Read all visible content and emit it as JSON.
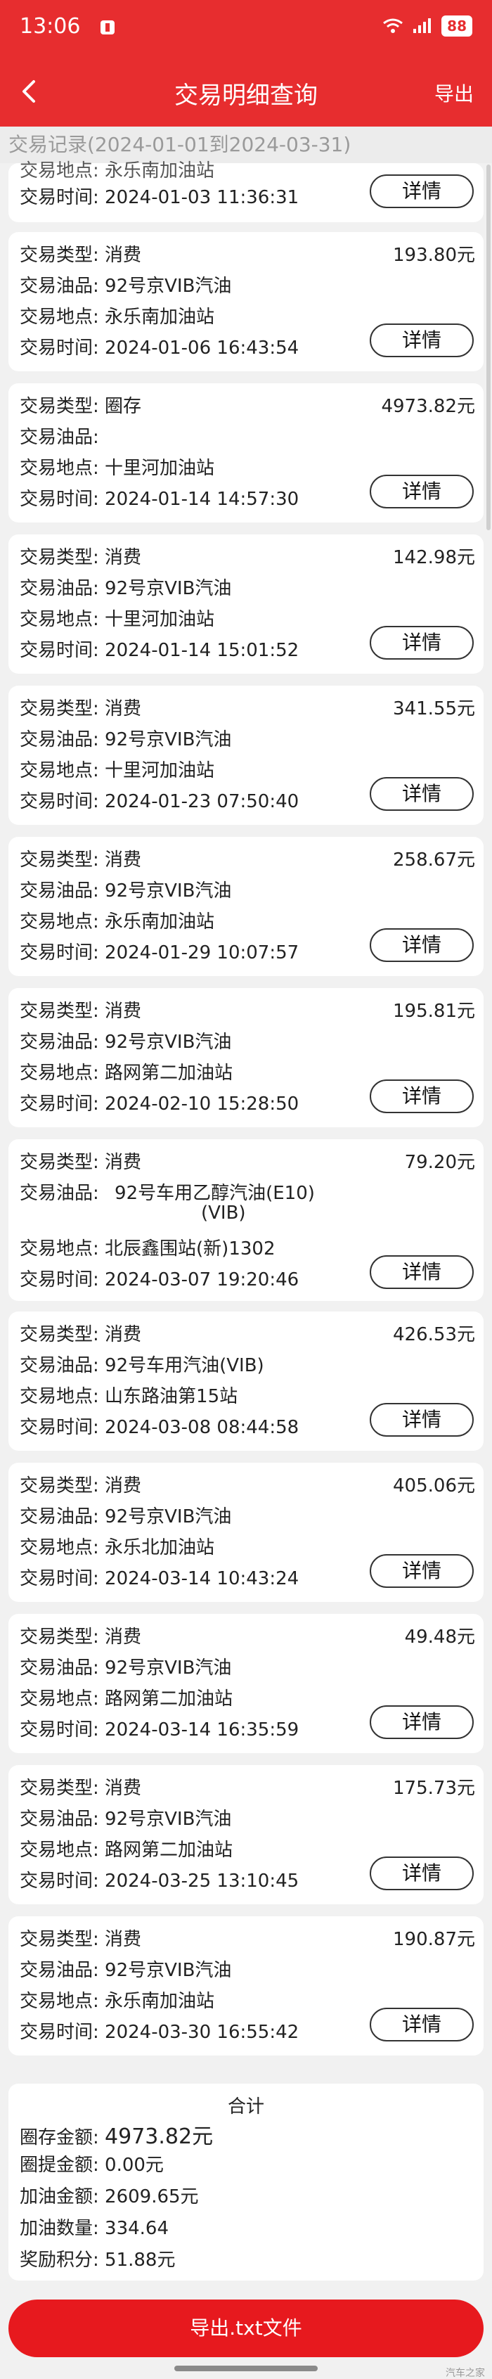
{
  "status": {
    "time": "13:06",
    "battery": "88"
  },
  "header": {
    "title": "交易明细查询",
    "export": "导出"
  },
  "subheader": "交易记录(2024-01-01到2024-03-31)",
  "labels": {
    "type": "交易类型:",
    "oil": "交易油品:",
    "place": "交易地点:",
    "time": "交易时间:",
    "detail": "详情"
  },
  "partial_record": {
    "place": "永乐南加油站",
    "time": "2024-01-03 11:36:31"
  },
  "records": [
    {
      "type": "消费",
      "amount": "193.80元",
      "oil": "92号京VIB汽油",
      "place": "永乐南加油站",
      "time": "2024-01-06 16:43:54"
    },
    {
      "type": "圈存",
      "amount": "4973.82元",
      "oil": "",
      "place": "十里河加油站",
      "time": "2024-01-14 14:57:30"
    },
    {
      "type": "消费",
      "amount": "142.98元",
      "oil": "92号京VIB汽油",
      "place": "十里河加油站",
      "time": "2024-01-14 15:01:52"
    },
    {
      "type": "消费",
      "amount": "341.55元",
      "oil": "92号京VIB汽油",
      "place": "十里河加油站",
      "time": "2024-01-23 07:50:40"
    },
    {
      "type": "消费",
      "amount": "258.67元",
      "oil": "92号京VIB汽油",
      "place": "永乐南加油站",
      "time": "2024-01-29 10:07:57"
    },
    {
      "type": "消费",
      "amount": "195.81元",
      "oil": "92号京VIB汽油",
      "place": "路网第二加油站",
      "time": "2024-02-10 15:28:50"
    },
    {
      "type": "消费",
      "amount": "79.20元",
      "oil": "92号车用乙醇汽油(E10)",
      "oil_line2": "(VIB)",
      "place": "北辰鑫围站(新)1302",
      "time": "2024-03-07 19:20:46"
    },
    {
      "type": "消费",
      "amount": "426.53元",
      "oil": "92号车用汽油(VIB)",
      "place": "山东路油第15站",
      "time": "2024-03-08 08:44:58"
    },
    {
      "type": "消费",
      "amount": "405.06元",
      "oil": "92号京VIB汽油",
      "place": "永乐北加油站",
      "time": "2024-03-14 10:43:24"
    },
    {
      "type": "消费",
      "amount": "49.48元",
      "oil": "92号京VIB汽油",
      "place": "路网第二加油站",
      "time": "2024-03-14 16:35:59"
    },
    {
      "type": "消费",
      "amount": "175.73元",
      "oil": "92号京VIB汽油",
      "place": "路网第二加油站",
      "time": "2024-03-25 13:10:45"
    },
    {
      "type": "消费",
      "amount": "190.87元",
      "oil": "92号京VIB汽油",
      "place": "永乐南加油站",
      "time": "2024-03-30 16:55:42"
    }
  ],
  "summary": {
    "title": "合计",
    "load_label": "圈存金额:",
    "load_value": "4973.82元",
    "withdraw_label": "圈提金额:",
    "withdraw_value": "0.00元",
    "fuel_amount_label": "加油金额:",
    "fuel_amount_value": "2609.65元",
    "fuel_qty_label": "加油数量:",
    "fuel_qty_value": "334.64",
    "points_label": "奖励积分:",
    "points_value": "51.88元"
  },
  "export_button": "导出.txt文件",
  "watermark": "汽车之家",
  "colors": {
    "brand_red": "#e72d2f",
    "export_red": "#e7191e"
  }
}
